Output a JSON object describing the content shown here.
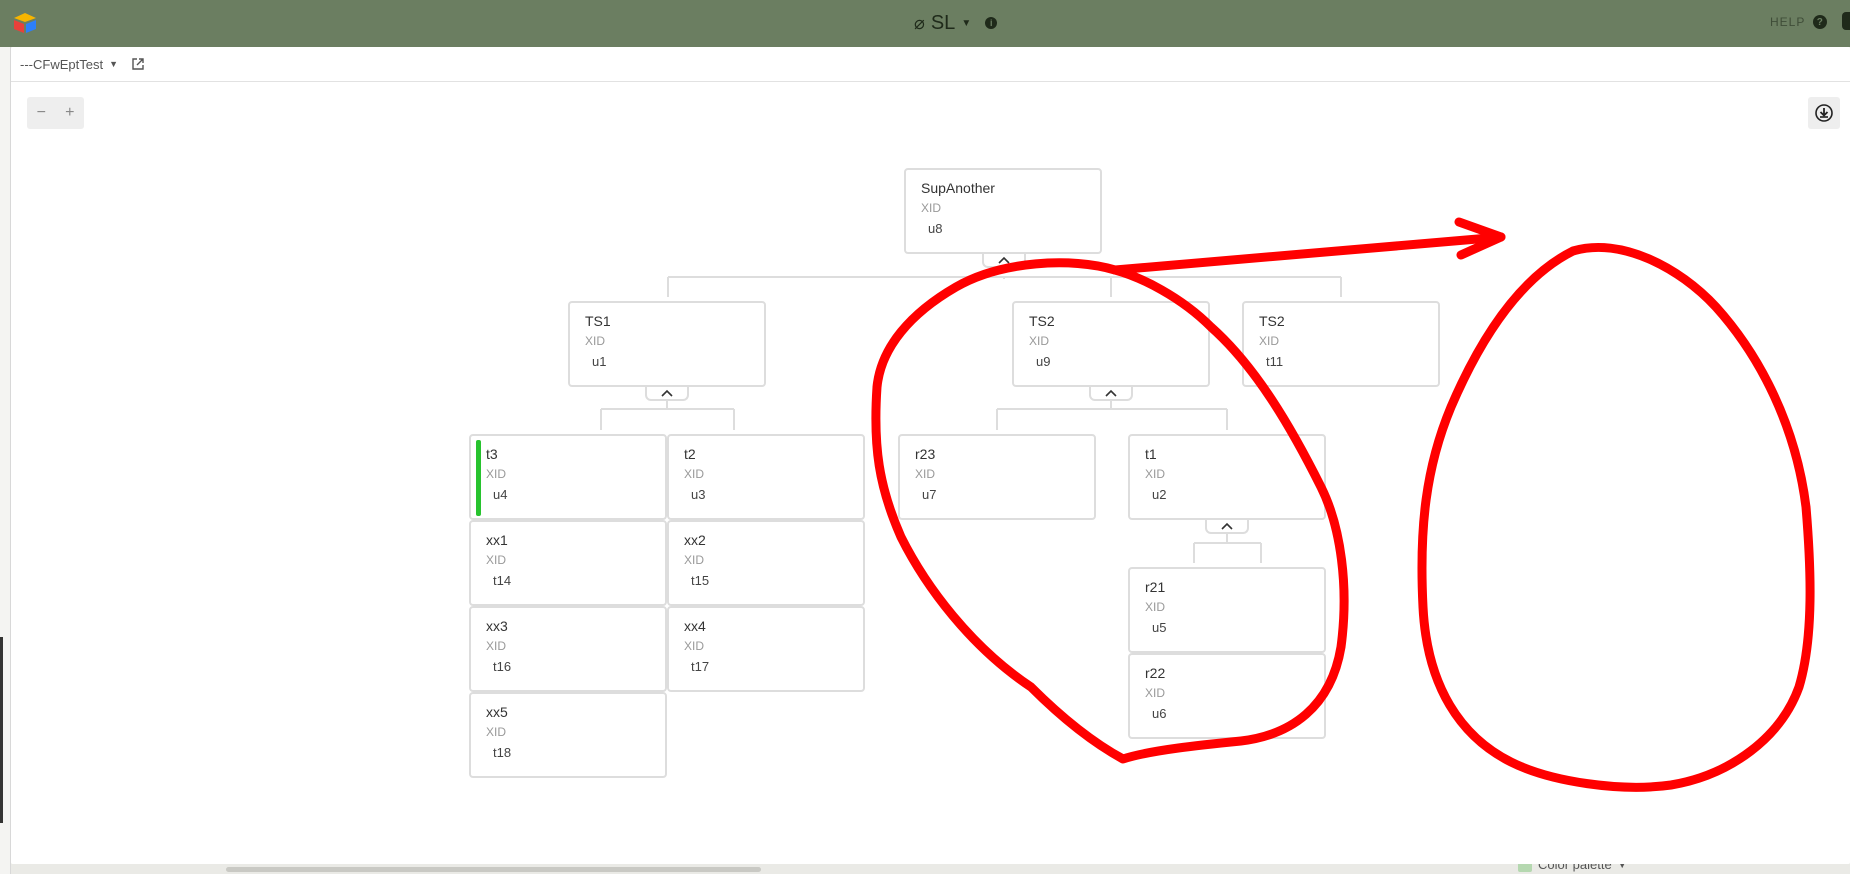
{
  "app": {
    "title": "SL",
    "help_label": "HELP"
  },
  "modal": {
    "widget_name": "---CFwEptTest",
    "zoom_out": "−",
    "zoom_in": "+"
  },
  "org": {
    "nodes": [
      {
        "id": "root",
        "name": "SupAnother",
        "xid_label": "XID",
        "value": "u8"
      },
      {
        "id": "ts1",
        "name": "TS1",
        "xid_label": "XID",
        "value": "u1"
      },
      {
        "id": "ts2a",
        "name": "TS2",
        "xid_label": "XID",
        "value": "u9"
      },
      {
        "id": "ts2b",
        "name": "TS2",
        "xid_label": "XID",
        "value": "t11"
      },
      {
        "id": "t3",
        "name": "t3",
        "xid_label": "XID",
        "value": "u4"
      },
      {
        "id": "t2",
        "name": "t2",
        "xid_label": "XID",
        "value": "u3"
      },
      {
        "id": "xx1",
        "name": "xx1",
        "xid_label": "XID",
        "value": "t14"
      },
      {
        "id": "xx2",
        "name": "xx2",
        "xid_label": "XID",
        "value": "t15"
      },
      {
        "id": "xx3",
        "name": "xx3",
        "xid_label": "XID",
        "value": "t16"
      },
      {
        "id": "xx4",
        "name": "xx4",
        "xid_label": "XID",
        "value": "t17"
      },
      {
        "id": "xx5",
        "name": "xx5",
        "xid_label": "XID",
        "value": "t18"
      },
      {
        "id": "r23",
        "name": "r23",
        "xid_label": "XID",
        "value": "u7"
      },
      {
        "id": "t1",
        "name": "t1",
        "xid_label": "XID",
        "value": "u2"
      },
      {
        "id": "r21",
        "name": "r21",
        "xid_label": "XID",
        "value": "u5"
      },
      {
        "id": "r22",
        "name": "r22",
        "xid_label": "XID",
        "value": "u6"
      }
    ]
  },
  "background": {
    "color_palette_label": "Color palette"
  },
  "colors": {
    "topbar": "#6b7e61",
    "selected": "#27c32e",
    "annotation": "#ff0000",
    "node_border": "#dddddd"
  }
}
